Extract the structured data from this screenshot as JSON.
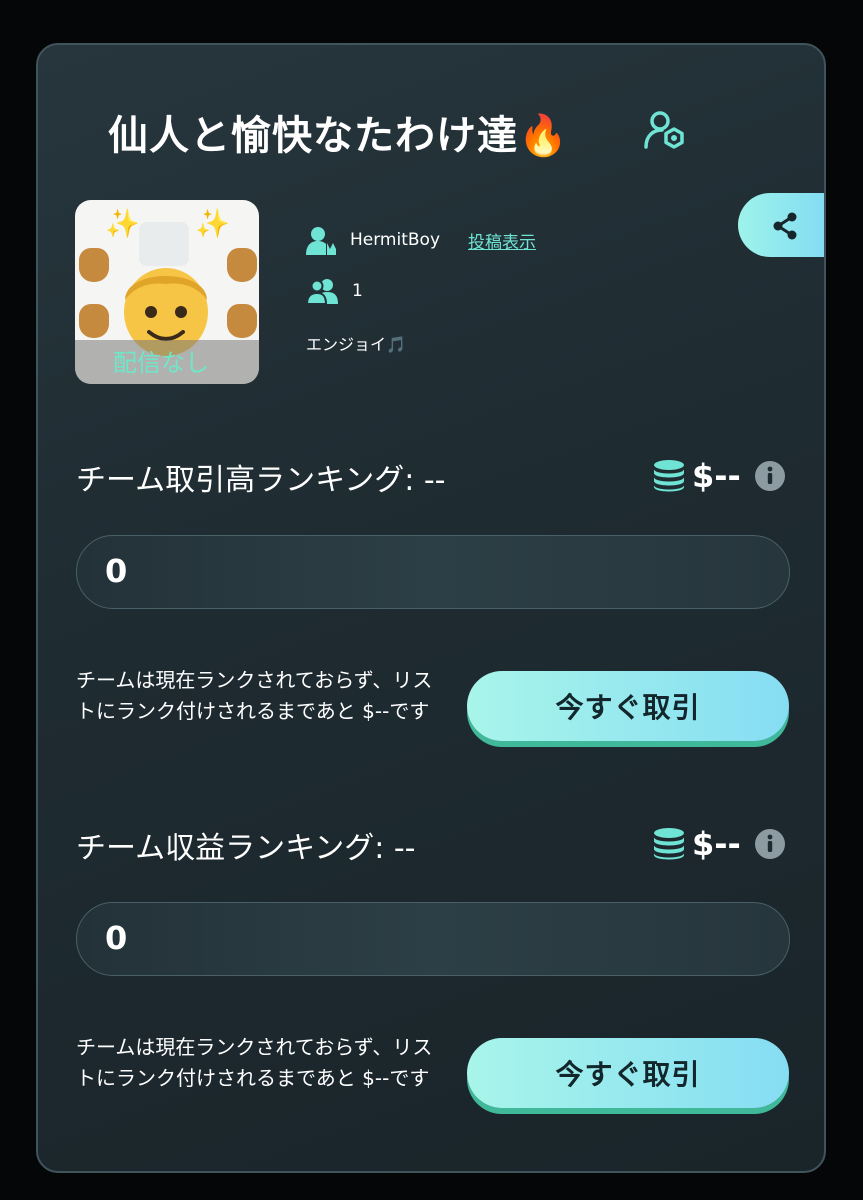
{
  "team": {
    "title": "仙人と愉快なたわけ達🔥",
    "avatar_overlay": "配信なし",
    "owner_name": "HermitBoy",
    "view_posts_link": "投稿表示",
    "member_count": "1",
    "description": "エンジョイ🎵"
  },
  "icons": {
    "title_badge": "team-settings-icon",
    "share": "share-icon",
    "owner": "owner-icon",
    "members": "members-icon",
    "coins": "coin-stack-icon",
    "info": "info-icon"
  },
  "colors": {
    "accent": "#6fe3d4",
    "button_gradient_start": "#a8f5ea",
    "button_gradient_end": "#86ddf3",
    "button_shadow": "#3fb99a",
    "card_bg": "#1e2b31"
  },
  "sections": [
    {
      "label": "チーム取引高ランキング: --",
      "amount": "$--",
      "value": "0",
      "note": "チームは現在ランクされておらず、リストにランク付けされるまであと $--です",
      "button": "今すぐ取引"
    },
    {
      "label": "チーム収益ランキング: --",
      "amount": "$--",
      "value": "0",
      "note": "チームは現在ランクされておらず、リストにランク付けされるまであと $--です",
      "button": "今すぐ取引"
    }
  ]
}
